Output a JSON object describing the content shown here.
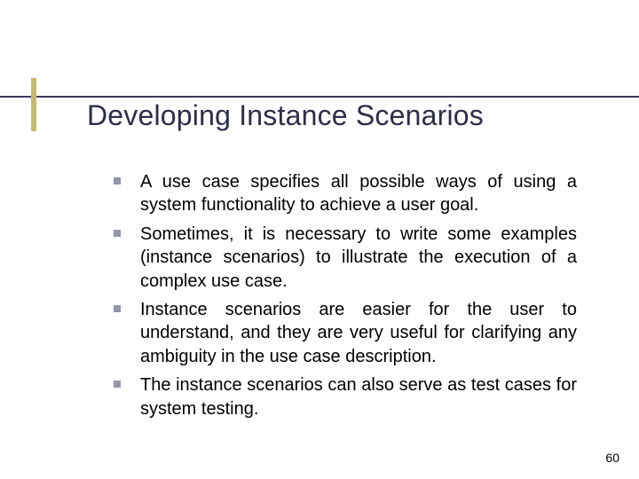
{
  "slide": {
    "title": "Developing Instance Scenarios",
    "bullets": [
      "A use case specifies all possible ways of using a system functionality to achieve a user goal.",
      "Sometimes, it is necessary to write some examples (instance scenarios) to illustrate the execution of a complex use case.",
      "Instance scenarios are easier for the user to understand, and they are very useful for clarifying any ambiguity in the use case description.",
      "The instance scenarios can also serve as test cases for system testing."
    ],
    "page_number": "60"
  }
}
